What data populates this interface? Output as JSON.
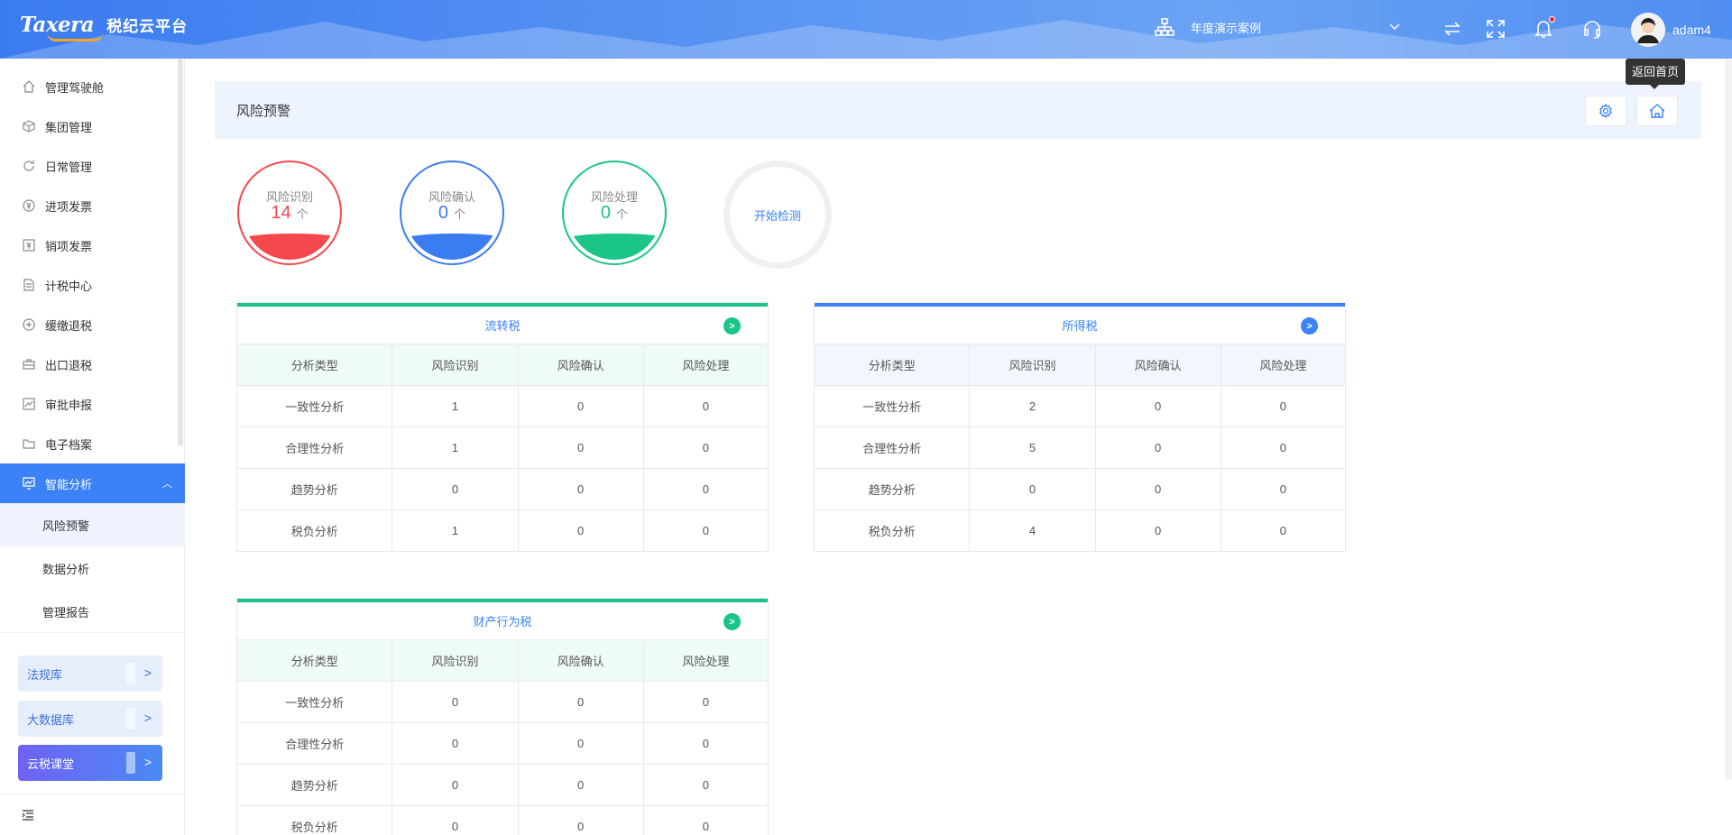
{
  "header": {
    "logo_text": "Taxera",
    "app_title": "税纪云平台",
    "org_name": "年度演示案例",
    "user_name": "adam4"
  },
  "sidebar": {
    "items": [
      {
        "label": "管理驾驶舱",
        "icon": "home-icon"
      },
      {
        "label": "集团管理",
        "icon": "cube-icon"
      },
      {
        "label": "日常管理",
        "icon": "refresh-icon"
      },
      {
        "label": "进项发票",
        "icon": "yen-circle-icon"
      },
      {
        "label": "销项发票",
        "icon": "yen-square-icon"
      },
      {
        "label": "计税中心",
        "icon": "document-icon"
      },
      {
        "label": "缓缴退税",
        "icon": "cycle-icon"
      },
      {
        "label": "出口退税",
        "icon": "briefcase-icon"
      },
      {
        "label": "审批申报",
        "icon": "chart-icon"
      },
      {
        "label": "电子档案",
        "icon": "folder-icon"
      }
    ],
    "active_item": {
      "label": "智能分析",
      "icon": "analysis-icon"
    },
    "sub_items": [
      "风险预警",
      "数据分析",
      "管理报告"
    ],
    "quick_links": [
      "法规库",
      "大数据库",
      "云税课堂"
    ]
  },
  "main": {
    "page_title": "风险预警",
    "tooltip": "返回首页",
    "stats": [
      {
        "label": "风险识别",
        "value": "14",
        "unit": "个",
        "color": "#f5484c",
        "fill": 0.28
      },
      {
        "label": "风险确认",
        "value": "0",
        "unit": "个",
        "color": "#3b7cf0",
        "fill": 0.28
      },
      {
        "label": "风险处理",
        "value": "0",
        "unit": "个",
        "color": "#1bc487",
        "fill": 0.28
      }
    ],
    "start_button": "开始检测",
    "columns": [
      "分析类型",
      "风险识别",
      "风险确认",
      "风险处理"
    ],
    "cards": [
      {
        "title": "流转税",
        "accent": "#1bc487",
        "rows": [
          [
            "一致性分析",
            "1",
            "0",
            "0"
          ],
          [
            "合理性分析",
            "1",
            "0",
            "0"
          ],
          [
            "趋势分析",
            "0",
            "0",
            "0"
          ],
          [
            "税负分析",
            "1",
            "0",
            "0"
          ]
        ]
      },
      {
        "title": "所得税",
        "accent": "#3b82f6",
        "rows": [
          [
            "一致性分析",
            "2",
            "0",
            "0"
          ],
          [
            "合理性分析",
            "5",
            "0",
            "0"
          ],
          [
            "趋势分析",
            "0",
            "0",
            "0"
          ],
          [
            "税负分析",
            "4",
            "0",
            "0"
          ]
        ]
      },
      {
        "title": "财产行为税",
        "accent": "#1bc487",
        "rows": [
          [
            "一致性分析",
            "0",
            "0",
            "0"
          ],
          [
            "合理性分析",
            "0",
            "0",
            "0"
          ],
          [
            "趋势分析",
            "0",
            "0",
            "0"
          ],
          [
            "税负分析",
            "0",
            "0",
            "0"
          ]
        ]
      }
    ]
  }
}
